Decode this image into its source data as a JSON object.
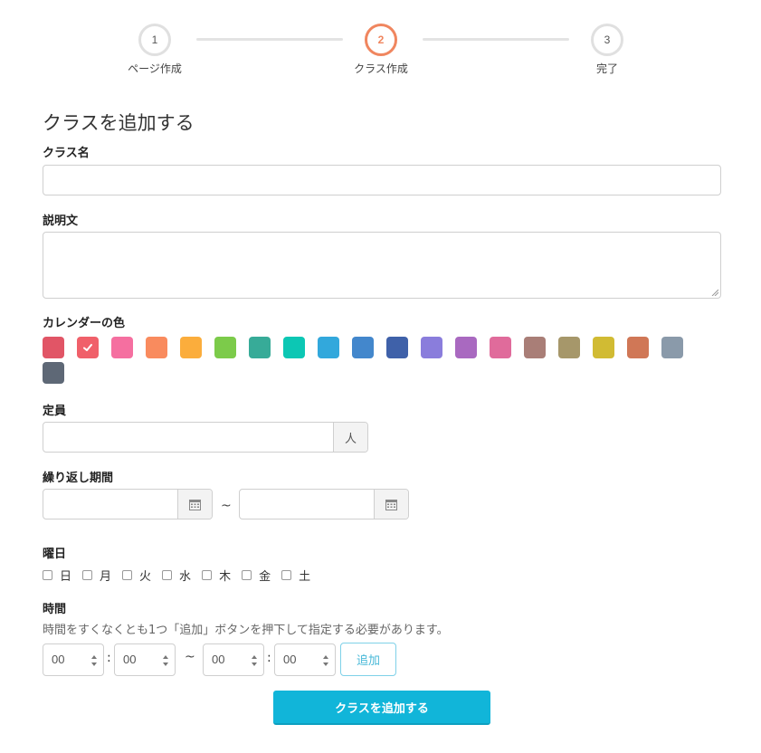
{
  "stepper": {
    "steps": [
      {
        "number": "1",
        "label": "ページ作成"
      },
      {
        "number": "2",
        "label": "クラス作成"
      },
      {
        "number": "3",
        "label": "完了"
      }
    ],
    "active_step": 2,
    "active_color": "#f0865f"
  },
  "form": {
    "title": "クラスを追加する",
    "class_name": {
      "label": "クラス名",
      "value": "",
      "placeholder": ""
    },
    "description": {
      "label": "説明文",
      "value": "",
      "placeholder": ""
    },
    "calendar_color": {
      "label": "カレンダーの色",
      "selected_index": 1,
      "colors": [
        "#e15566",
        "#f0606a",
        "#f56fa0",
        "#f98b5e",
        "#fbad3c",
        "#7ccb4a",
        "#37ab98",
        "#0cc7b4",
        "#32a8dc",
        "#4387cc",
        "#3f61a9",
        "#8a7ddc",
        "#a969c0",
        "#e06b9b",
        "#a97e77",
        "#a6976a",
        "#d1bb33",
        "#d07756",
        "#8a9aaa",
        "#5e6876"
      ],
      "icons": {
        "check": "check-icon"
      }
    },
    "capacity": {
      "label": "定員",
      "value": "",
      "unit": "人"
    },
    "repeat_period": {
      "label": "繰り返し期間",
      "start": "",
      "end": "",
      "separator": "~",
      "icon": "calendar-icon"
    },
    "weekdays": {
      "label": "曜日",
      "days": [
        {
          "label": "日",
          "checked": false
        },
        {
          "label": "月",
          "checked": false
        },
        {
          "label": "火",
          "checked": false
        },
        {
          "label": "水",
          "checked": false
        },
        {
          "label": "木",
          "checked": false
        },
        {
          "label": "金",
          "checked": false
        },
        {
          "label": "土",
          "checked": false
        }
      ]
    },
    "time": {
      "label": "時間",
      "hint": "時間をすくなくとも1つ「追加」ボタンを押下して指定する必要があります。",
      "start_hour": "00",
      "start_minute": "00",
      "end_hour": "00",
      "end_minute": "00",
      "colon": ":",
      "separator": "~",
      "add_label": "追加"
    },
    "submit_label": "クラスを追加する",
    "submit_color": "#11b5d9"
  }
}
